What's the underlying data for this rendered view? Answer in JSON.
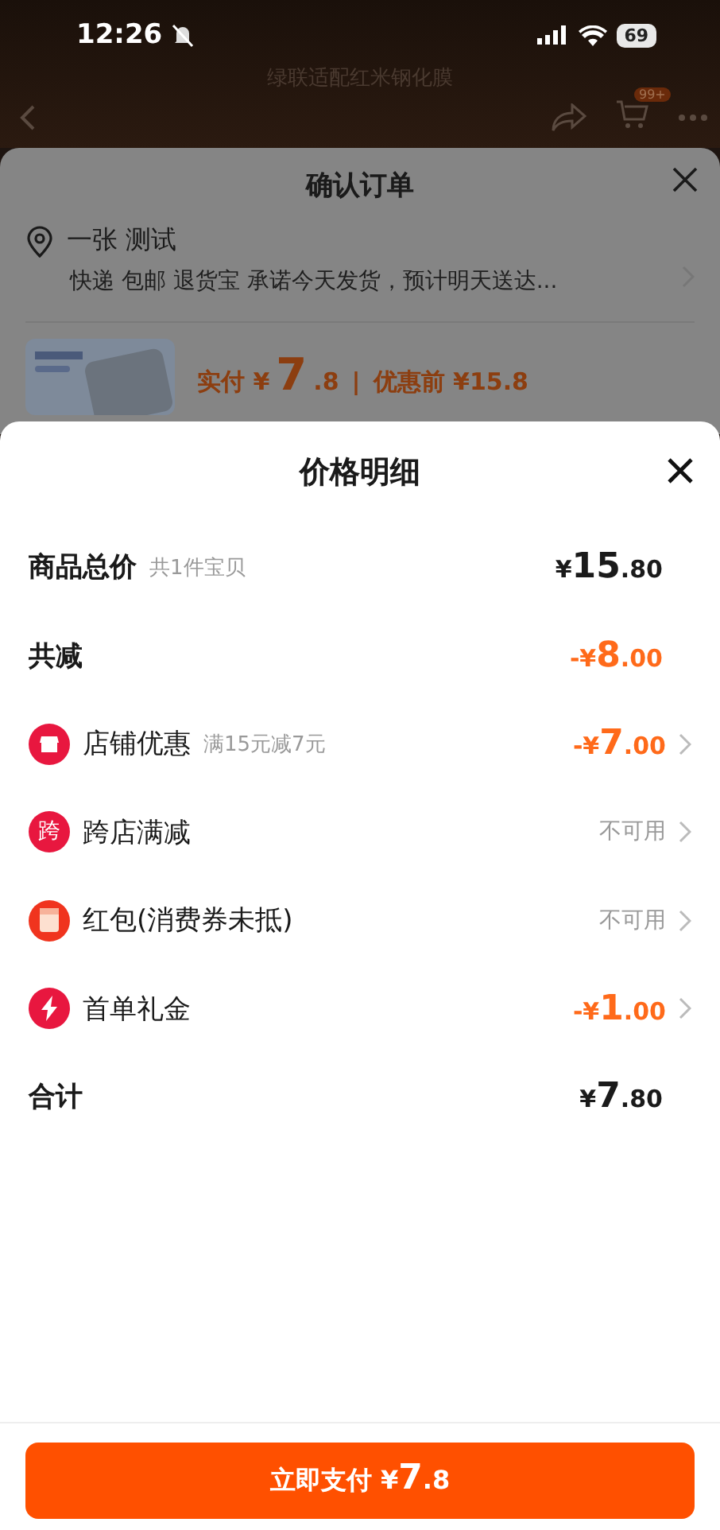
{
  "status_bar": {
    "time": "12:26",
    "battery": "69"
  },
  "background_page": {
    "subtitle": "绿联适配红米钢化膜",
    "cart_badge": "99+"
  },
  "order_sheet": {
    "title": "确认订单",
    "address": "一张 测试",
    "delivery": "快递 包邮 退货宝 承诺今天发货，预计明天送达...",
    "paid_label": "实付",
    "paid_currency": "¥",
    "paid_main": "7",
    "paid_fraction": ".8",
    "separator": "|",
    "before_label": "优惠前",
    "before_amount": "¥15.8"
  },
  "price_sheet": {
    "title": "价格明细",
    "rows": [
      {
        "kind": "plain",
        "label": "商品总价",
        "note": "共1件宝贝",
        "value": {
          "kind": "normal",
          "prefix": "¥",
          "main": "15",
          "fraction": ".80"
        }
      },
      {
        "kind": "plain",
        "label": "共减",
        "value": {
          "kind": "discount",
          "prefix": "-¥",
          "main": "8",
          "fraction": ".00"
        }
      },
      {
        "kind": "store",
        "label": "店铺优惠",
        "note": "满15元减7元",
        "value": {
          "kind": "discount",
          "prefix": "-¥",
          "main": "7",
          "fraction": ".00"
        }
      },
      {
        "kind": "badge",
        "icon_text": "跨",
        "label": "跨店满减",
        "value": {
          "kind": "unavailable",
          "text": "不可用"
        }
      },
      {
        "kind": "envelope",
        "label": "红包(消费券未抵)",
        "value": {
          "kind": "unavailable",
          "text": "不可用"
        }
      },
      {
        "kind": "bolt",
        "label": "首单礼金",
        "value": {
          "kind": "discount",
          "prefix": "-¥",
          "main": "1",
          "fraction": ".00"
        }
      },
      {
        "kind": "plain",
        "label": "合计",
        "value": {
          "kind": "normal",
          "prefix": "¥",
          "main": "7",
          "fraction": ".80"
        }
      }
    ]
  },
  "pay_button": {
    "label": "立即支付",
    "prefix": "¥",
    "main": "7",
    "fraction": ".8"
  }
}
